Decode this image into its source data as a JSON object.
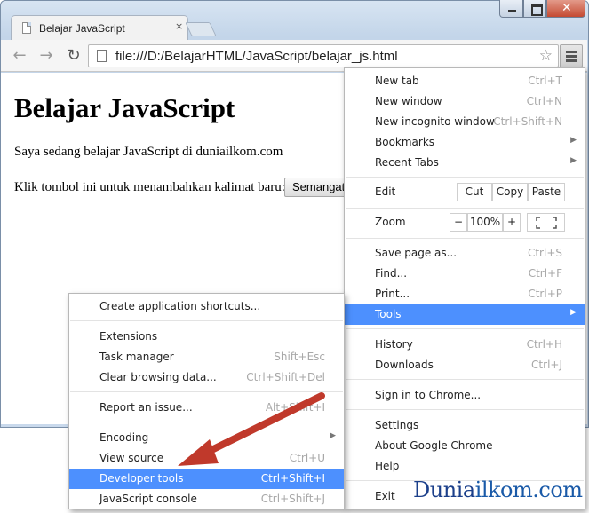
{
  "tab": {
    "title": "Belajar JavaScript",
    "close": "×"
  },
  "omnibox": {
    "url": "file:///D:/BelajarHTML/JavaScript/belajar_js.html"
  },
  "page": {
    "heading": "Belajar JavaScript",
    "para1": "Saya sedang belajar JavaScript di duniailkom.com",
    "para2": "Klik tombol ini untuk menambahkan kalimat baru:",
    "button": "Semangat!"
  },
  "main_menu": {
    "new_tab": {
      "label": "New tab",
      "shortcut": "Ctrl+T"
    },
    "new_window": {
      "label": "New window",
      "shortcut": "Ctrl+N"
    },
    "new_incognito": {
      "label": "New incognito window",
      "shortcut": "Ctrl+Shift+N"
    },
    "bookmarks": {
      "label": "Bookmarks"
    },
    "recent_tabs": {
      "label": "Recent Tabs"
    },
    "edit": {
      "label": "Edit",
      "cut": "Cut",
      "copy": "Copy",
      "paste": "Paste"
    },
    "zoom": {
      "label": "Zoom",
      "minus": "−",
      "level": "100%",
      "plus": "+"
    },
    "save_page": {
      "label": "Save page as...",
      "shortcut": "Ctrl+S"
    },
    "find": {
      "label": "Find...",
      "shortcut": "Ctrl+F"
    },
    "print": {
      "label": "Print...",
      "shortcut": "Ctrl+P"
    },
    "tools": {
      "label": "Tools"
    },
    "history": {
      "label": "History",
      "shortcut": "Ctrl+H"
    },
    "downloads": {
      "label": "Downloads",
      "shortcut": "Ctrl+J"
    },
    "sign_in": {
      "label": "Sign in to Chrome..."
    },
    "settings": {
      "label": "Settings"
    },
    "about": {
      "label": "About Google Chrome"
    },
    "help": {
      "label": "Help"
    },
    "exit": {
      "label": "Exit"
    }
  },
  "tools_menu": {
    "create_shortcuts": {
      "label": "Create application shortcuts..."
    },
    "extensions": {
      "label": "Extensions"
    },
    "task_manager": {
      "label": "Task manager",
      "shortcut": "Shift+Esc"
    },
    "clear_browsing": {
      "label": "Clear browsing data...",
      "shortcut": "Ctrl+Shift+Del"
    },
    "report_issue": {
      "label": "Report an issue...",
      "shortcut": "Alt+Shift+I"
    },
    "encoding": {
      "label": "Encoding"
    },
    "view_source": {
      "label": "View source",
      "shortcut": "Ctrl+U"
    },
    "developer_tools": {
      "label": "Developer tools",
      "shortcut": "Ctrl+Shift+I"
    },
    "js_console": {
      "label": "JavaScript console",
      "shortcut": "Ctrl+Shift+J"
    }
  },
  "watermark": {
    "part1": "Dunia",
    "part2": "ilkom.com"
  },
  "colors": {
    "highlight": "#4d90fe",
    "arrow": "#c0392b",
    "watermark": "#1a5aa8"
  }
}
